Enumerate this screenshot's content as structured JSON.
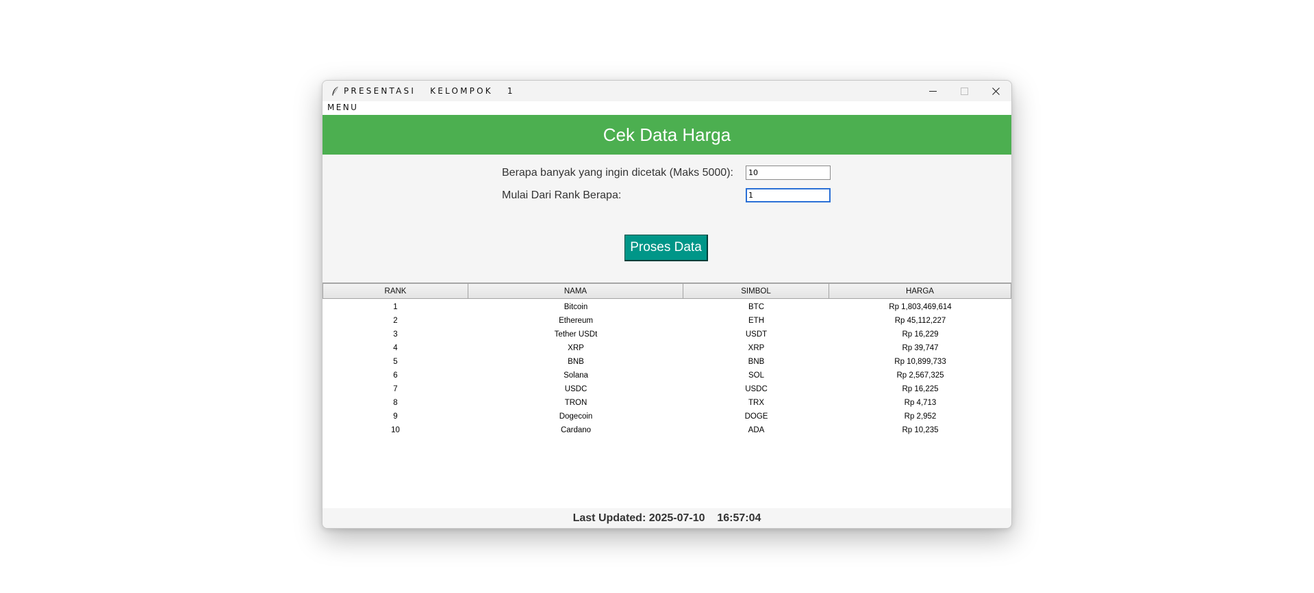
{
  "window": {
    "title": "PRESENTASI   KELOMPOK   1",
    "icon": "feather-icon",
    "controls": [
      "minimize-icon",
      "maximize-icon",
      "close-icon"
    ]
  },
  "menubar": {
    "menu_label": "MENU"
  },
  "header": {
    "title": "Cek Data Harga",
    "color": "#4caf50"
  },
  "form": {
    "count_label": "Berapa banyak yang ingin dicetak (Maks 5000):",
    "count_value": "10",
    "rank_label": "Mulai Dari Rank Berapa:",
    "rank_value": "1"
  },
  "process_button": {
    "label": "Proses Data",
    "color": "#009688"
  },
  "table": {
    "columns": [
      "RANK",
      "NAMA",
      "SIMBOL",
      "HARGA"
    ],
    "rows": [
      [
        "1",
        "Bitcoin",
        "BTC",
        "Rp 1,803,469,614"
      ],
      [
        "2",
        "Ethereum",
        "ETH",
        "Rp 45,112,227"
      ],
      [
        "3",
        "Tether USDt",
        "USDT",
        "Rp 16,229"
      ],
      [
        "4",
        "XRP",
        "XRP",
        "Rp 39,747"
      ],
      [
        "5",
        "BNB",
        "BNB",
        "Rp 10,899,733"
      ],
      [
        "6",
        "Solana",
        "SOL",
        "Rp 2,567,325"
      ],
      [
        "7",
        "USDC",
        "USDC",
        "Rp 16,225"
      ],
      [
        "8",
        "TRON",
        "TRX",
        "Rp 4,713"
      ],
      [
        "9",
        "Dogecoin",
        "DOGE",
        "Rp 2,952"
      ],
      [
        "10",
        "Cardano",
        "ADA",
        "Rp 10,235"
      ]
    ]
  },
  "status": {
    "last_updated": "Last Updated: 2025-07-10    16:57:04"
  }
}
